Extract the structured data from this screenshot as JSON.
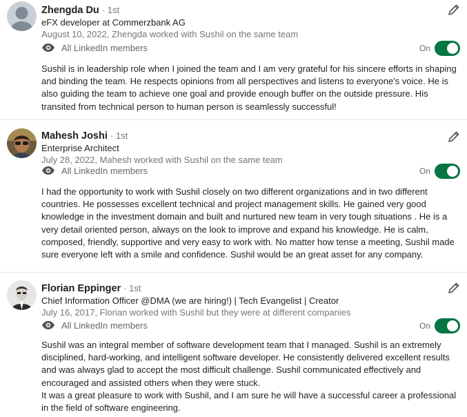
{
  "recommendations": [
    {
      "name": "Zhengda Du",
      "degree": "· 1st",
      "headline": "eFX developer at Commerzbank AG",
      "date_relation": "August 10, 2022, Zhengda worked with Sushil on the same team",
      "visibility": "All LinkedIn members",
      "toggle_label": "On",
      "text": "Sushil is in leadership role when I joined the team and I am very grateful for his sincere efforts in shaping and binding the team. He respects opinions from all perspectives and listens to everyone's voice. He is also guiding the team to achieve one goal and provide enough buffer on the outside pressure. His transited from technical person to human person is seamlessly successful!"
    },
    {
      "name": "Mahesh Joshi",
      "degree": "· 1st",
      "headline": "Enterprise Architect",
      "date_relation": "July 28, 2022, Mahesh worked with Sushil on the same team",
      "visibility": "All LinkedIn members",
      "toggle_label": "On",
      "text": "I had the opportunity to work with Sushil closely on two different organizations and in two different countries. He possesses excellent technical and project management skills. He gained very good knowledge in the investment domain and built and nurtured new team in very tough situations . He is a very detail oriented person, always on the look to improve and expand his knowledge. He is calm, composed, friendly, supportive and very easy to work with. No matter how tense a meeting, Sushil made sure everyone left with a smile and confidence. Sushil would be an great asset for any company."
    },
    {
      "name": "Florian Eppinger",
      "degree": "· 1st",
      "headline": "Chief Information Officer @DMA (we are hiring!) | Tech Evangelist | Creator",
      "date_relation": "July 16, 2017, Florian worked with Sushil but they were at different companies",
      "visibility": "All LinkedIn members",
      "toggle_label": "On",
      "text": "Sushil was an integral member of software development team that I managed. Sushil is an extremely disciplined, hard-working, and intelligent software developer. He consistently delivered excellent results and was always glad to accept the most difficult challenge. Sushil communicated effectively and encouraged and assisted others when they were stuck.\nIt was a great pleasure to work with Sushil, and I am sure he will have a successful career a professional in the field of software engineering."
    }
  ],
  "colors": {
    "toggle_on": "#057642",
    "muted_text": "#767676",
    "divider": "#e3e3e3"
  },
  "icons": [
    "eye-icon",
    "pencil-icon"
  ]
}
